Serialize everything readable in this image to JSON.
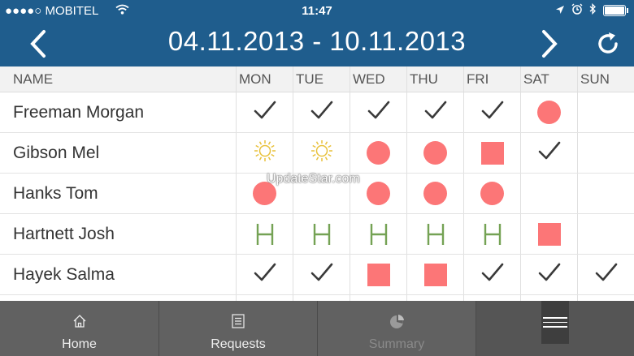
{
  "status": {
    "carrier": "●●●●○ MOBITEL",
    "time": "11:47"
  },
  "header": {
    "title": "04.11.2013 - 10.11.2013"
  },
  "table": {
    "headers": [
      "NAME",
      "MON",
      "TUE",
      "WED",
      "THU",
      "FRI",
      "SAT",
      "SUN"
    ],
    "rows": [
      {
        "name": "Freeman Morgan",
        "days": [
          "check",
          "check",
          "check",
          "check",
          "check",
          "dot",
          ""
        ]
      },
      {
        "name": "Gibson Mel",
        "days": [
          "sun",
          "sun",
          "dot",
          "dot",
          "square",
          "check",
          ""
        ]
      },
      {
        "name": "Hanks Tom",
        "days": [
          "dot",
          "",
          "dot",
          "dot",
          "dot",
          "",
          ""
        ]
      },
      {
        "name": "Hartnett Josh",
        "days": [
          "H",
          "H",
          "H",
          "H",
          "H",
          "square",
          ""
        ]
      },
      {
        "name": "Hayek Salma",
        "days": [
          "check",
          "check",
          "square",
          "square",
          "check",
          "check",
          "check"
        ]
      }
    ]
  },
  "watermark": "UpdateStar.com",
  "tabs": [
    {
      "label": "Home",
      "icon": "home-icon"
    },
    {
      "label": "Requests",
      "icon": "list-icon"
    },
    {
      "label": "Summary",
      "icon": "pie-chart-icon"
    }
  ],
  "colors": {
    "primary": "#1f5d8d",
    "red": "#fc7677",
    "green": "#74a254",
    "sun": "#e8c13a",
    "tabbar": "#616161"
  }
}
